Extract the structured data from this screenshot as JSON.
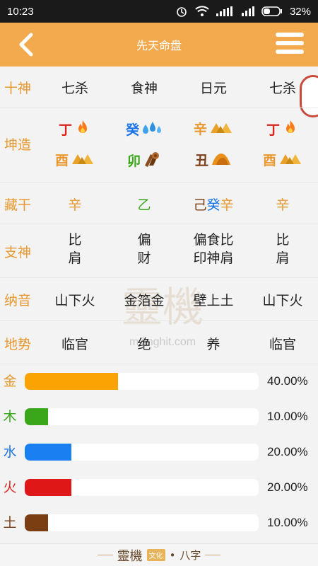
{
  "status": {
    "time": "10:23",
    "battery": "32%"
  },
  "header": {
    "title": "先天命盘"
  },
  "rows": {
    "shishen": {
      "label": "十神",
      "cells": [
        "七杀",
        "食神",
        "日元",
        "七杀"
      ]
    },
    "kunzao": {
      "label": "坤造",
      "stems": [
        {
          "char": "丁",
          "color": "#d9251c",
          "icon": "fire-icon"
        },
        {
          "char": "癸",
          "color": "#1a73e8",
          "icon": "water-drops-icon"
        },
        {
          "char": "辛",
          "color": "#e8982f",
          "icon": "gold-bars-icon"
        },
        {
          "char": "丁",
          "color": "#d9251c",
          "icon": "fire-icon"
        }
      ],
      "branches": [
        {
          "char": "酉",
          "color": "#e8982f",
          "icon": "gold-bars-icon"
        },
        {
          "char": "卯",
          "color": "#3aa61a",
          "icon": "wood-logs-icon"
        },
        {
          "char": "丑",
          "color": "#7a3e12",
          "icon": "earth-mound-icon"
        },
        {
          "char": "酉",
          "color": "#e8982f",
          "icon": "gold-bars-icon"
        }
      ]
    },
    "canggan": {
      "label": "藏干",
      "cells": [
        [
          {
            "t": "辛",
            "color": "#e8982f"
          }
        ],
        [
          {
            "t": "乙",
            "color": "#3aa61a"
          }
        ],
        [
          {
            "t": "己",
            "color": "#7a3e12"
          },
          {
            "t": "癸",
            "color": "#1a73e8"
          },
          {
            "t": "辛",
            "color": "#e8982f"
          }
        ],
        [
          {
            "t": "辛",
            "color": "#e8982f"
          }
        ]
      ]
    },
    "zhishen": {
      "label": "支神",
      "cells": [
        [
          "比",
          "肩"
        ],
        [
          "偏",
          "财"
        ],
        [
          "偏食比",
          "印神肩"
        ],
        [
          "比",
          "肩"
        ]
      ]
    },
    "nayin": {
      "label": "纳音",
      "cells": [
        "山下火",
        "金箔金",
        "壁上土",
        "山下火"
      ]
    },
    "dishi": {
      "label": "地势",
      "cells": [
        "临官",
        "绝",
        "养",
        "临官"
      ]
    }
  },
  "watermark": {
    "text": "靈機",
    "url": "m.linghit.com"
  },
  "elements": [
    {
      "label": "金",
      "value": 40,
      "pct": "40.00%",
      "color": "#fba302",
      "label_color": "#e8982f"
    },
    {
      "label": "木",
      "value": 10,
      "pct": "10.00%",
      "color": "#3aa61a",
      "label_color": "#3aa61a"
    },
    {
      "label": "水",
      "value": 20,
      "pct": "20.00%",
      "color": "#1a7ff0",
      "label_color": "#1a73e8"
    },
    {
      "label": "火",
      "value": 20,
      "pct": "20.00%",
      "color": "#e01717",
      "label_color": "#d9251c"
    },
    {
      "label": "土",
      "value": 10,
      "pct": "10.00%",
      "color": "#7a3e12",
      "label_color": "#7a3e12"
    }
  ],
  "footer": {
    "brand": "靈機",
    "tag": "文化",
    "dot": "•",
    "suffix": "八字"
  }
}
